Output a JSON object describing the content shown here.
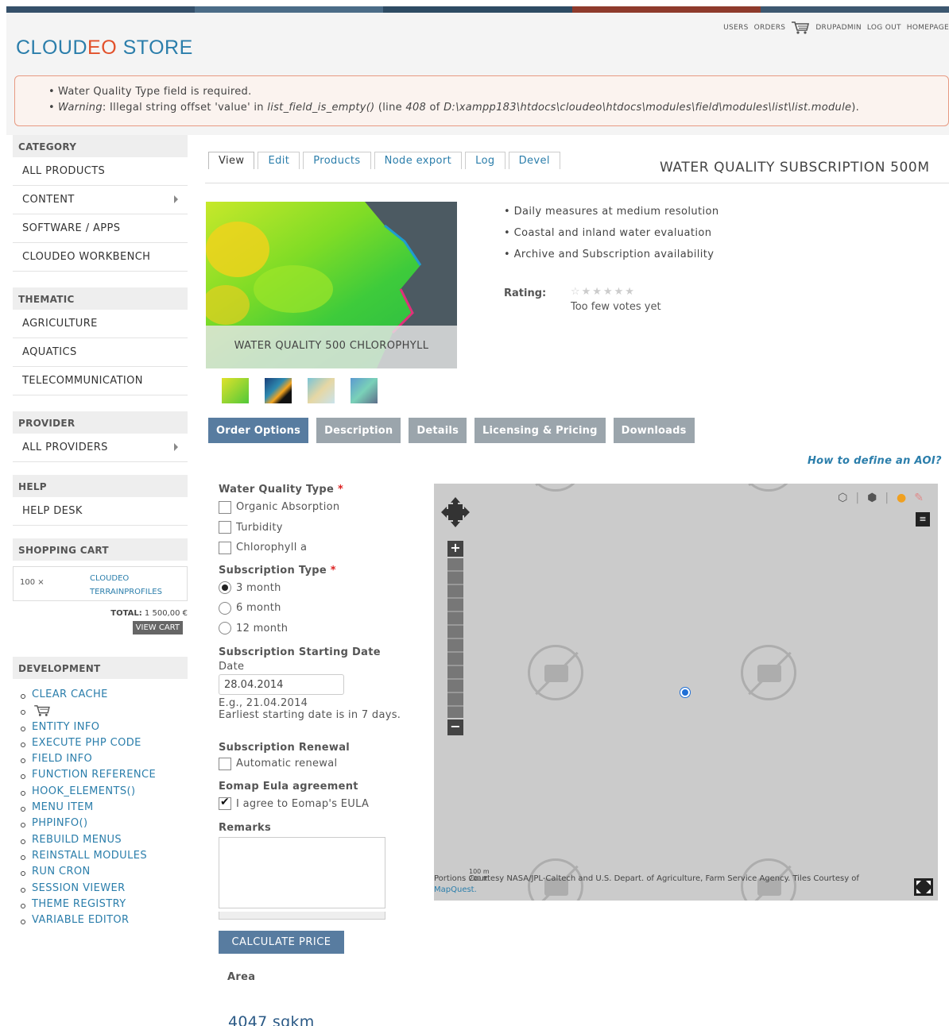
{
  "header": {
    "logo_cloud": "CLOUD",
    "logo_eo": "EO",
    "logo_store": " STORE",
    "nav": [
      "USERS",
      "ORDERS",
      "DRUPADMIN",
      "LOG OUT",
      "HOMEPAGE"
    ]
  },
  "messages": {
    "line1": "Water Quality Type field is required.",
    "line2_prefix": "Warning",
    "line2_a": ": Illegal string offset 'value' in ",
    "line2_fn": "list_field_is_empty()",
    "line2_b": " (line ",
    "line2_line": "408",
    "line2_c": " of ",
    "line2_path": "D:\\xampp183\\htdocs\\cloudeo\\htdocs\\modules\\field\\modules\\list\\list.module",
    "line2_d": ")."
  },
  "sidebar": {
    "category": {
      "title": "CATEGORY",
      "items": [
        "ALL PRODUCTS",
        "CONTENT",
        "SOFTWARE / APPS",
        "CLOUDEO WORKBENCH"
      ]
    },
    "thematic": {
      "title": "THEMATIC",
      "items": [
        "AGRICULTURE",
        "AQUATICS",
        "TELECOMMUNICATION"
      ]
    },
    "provider": {
      "title": "PROVIDER",
      "items": [
        "ALL PROVIDERS"
      ]
    },
    "help": {
      "title": "HELP",
      "items": [
        "HELP DESK"
      ]
    },
    "cart": {
      "title": "SHOPPING CART",
      "qty": "100 ×",
      "name1": "CLOUDEO",
      "name2": "TERRAINPROFILES",
      "total_label": "TOTAL:",
      "total_value": "1 500,00 €",
      "view_cart": "VIEW CART"
    },
    "development": {
      "title": "DEVELOPMENT",
      "items": [
        "CLEAR CACHE",
        "",
        "ENTITY INFO",
        "EXECUTE PHP CODE",
        "FIELD INFO",
        "FUNCTION REFERENCE",
        "HOOK_ELEMENTS()",
        "MENU ITEM",
        "PHPINFO()",
        "REBUILD MENUS",
        "REINSTALL MODULES",
        "RUN CRON",
        "SESSION VIEWER",
        "THEME REGISTRY",
        "VARIABLE EDITOR"
      ]
    }
  },
  "tabs": [
    "View",
    "Edit",
    "Products",
    "Node export",
    "Log",
    "Devel"
  ],
  "product": {
    "title": "WATER QUALITY SUBSCRIPTION 500M",
    "image_caption": "WATER QUALITY 500 CHLOROPHYLL",
    "features": [
      "Daily measures at medium resolution",
      "Coastal and inland water evaluation",
      "Archive and Subscription availability"
    ],
    "rating_label": "Rating:",
    "stars": "☆★★★★★",
    "votes": "Too few votes yet"
  },
  "order_tabs": [
    "Order Options",
    "Description",
    "Details",
    "Licensing & Pricing",
    "Downloads"
  ],
  "aoi_link": "How to define an AOI?",
  "form": {
    "wq_label": "Water Quality Type",
    "wq_options": [
      "Organic Absorption",
      "Turbidity",
      "Chlorophyll a"
    ],
    "sub_label": "Subscription Type",
    "sub_options": [
      "3 month",
      "6 month",
      "12 month"
    ],
    "start_label": "Subscription Starting Date",
    "date_label": "Date",
    "date_value": "28.04.2014",
    "date_eg": "E.g., 21.04.2014",
    "date_note": "Earliest starting date is in 7 days.",
    "renew_label": "Subscription Renewal",
    "renew_option": "Automatic renewal",
    "eula_label": "Eomap Eula agreement",
    "eula_option": "I agree to Eomap's EULA",
    "remarks_label": "Remarks",
    "calc_button": "CALCULATE PRICE",
    "area_label": "Area",
    "area_value": "4047 sqkm",
    "required_mark": "*"
  },
  "map": {
    "attribution": "Portions Courtesy NASA/JPL-Caltech and U.S. Depart. of Agriculture, Farm Service Agency. Tiles Courtesy of",
    "attribution_link": "MapQuest.",
    "scale_top": "100 m",
    "scale_bottom": "200 ft"
  }
}
